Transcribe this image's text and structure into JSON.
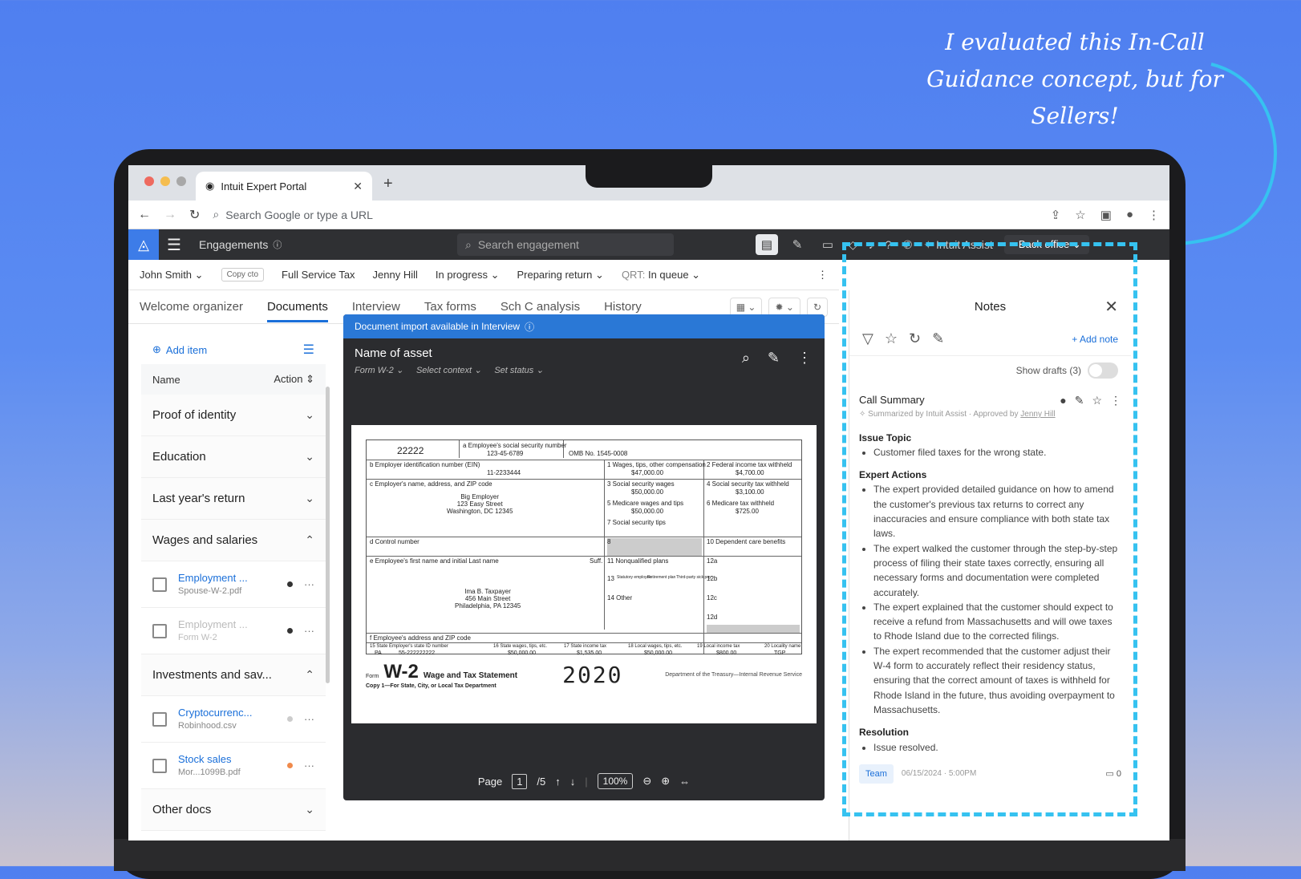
{
  "annotation": {
    "text": "I evaluated this In-Call Guidance concept, but for Sellers!"
  },
  "browser": {
    "tab_title": "Intuit Expert Portal",
    "url_placeholder": "Search Google or type a URL"
  },
  "appbar": {
    "section": "Engagements",
    "search_placeholder": "Search engagement",
    "assist": "Intuit Assist",
    "back_office": "Back office"
  },
  "engagement": {
    "client": "John Smith",
    "copy": "Copy cto",
    "service": "Full Service Tax",
    "expert": "Jenny Hill",
    "status": "In progress",
    "stage": "Preparing return",
    "qrt_label": "QRT:",
    "qrt_value": "In queue"
  },
  "subtabs": [
    "Welcome organizer",
    "Documents",
    "Interview",
    "Tax forms",
    "Sch C analysis",
    "History"
  ],
  "docs": {
    "add_item": "Add item",
    "col_name": "Name",
    "col_action": "Action",
    "sections": {
      "proof": "Proof of identity",
      "education": "Education",
      "last_year": "Last year's return",
      "wages": "Wages and salaries",
      "investments": "Investments and sav...",
      "other": "Other docs"
    },
    "wages_items": [
      {
        "title": "Employment ...",
        "file": "Spouse-W-2.pdf"
      },
      {
        "title": "Employment ...",
        "file": "Form W-2"
      }
    ],
    "invest_items": [
      {
        "title": "Cryptocurrenc...",
        "file": "Robinhood.csv"
      },
      {
        "title": "Stock sales",
        "file": "Mor...1099B.pdf"
      }
    ]
  },
  "viewer": {
    "banner": "Document import available in Interview",
    "name": "Name of asset",
    "form": "Form W-2",
    "context": "Select context",
    "status": "Set status",
    "page_label": "Page",
    "page": "1",
    "page_total": "/5",
    "zoom": "100%"
  },
  "w2": {
    "control": "22222",
    "ssn_label": "a Employee's social security number",
    "ssn": "123-45-6789",
    "omb": "OMB No. 1545-0008",
    "ein_label": "b Employer identification number (EIN)",
    "ein": "11-2233444",
    "employer_label": "c Employer's name, address, and ZIP code",
    "employer": "Big Employer\n123 Easy Street\nWashington, DC 12345",
    "box1_label": "1 Wages, tips, other compensation",
    "box1": "$47,000.00",
    "box2_label": "2 Federal income tax withheld",
    "box2": "$4,700.00",
    "box3_label": "3 Social security wages",
    "box3": "$50,000.00",
    "box4_label": "4 Social security tax withheld",
    "box4": "$3,100.00",
    "box5_label": "5 Medicare wages and tips",
    "box5": "$50,000.00",
    "box6_label": "6 Medicare tax withheld",
    "box6": "$725.00",
    "box7_label": "7 Social security tips",
    "box8": "8",
    "box10_label": "10 Dependent care benefits",
    "d_label": "d Control number",
    "e_label": "e Employee's first name and initial     Last name",
    "suff": "Suff.",
    "box11_label": "11 Nonqualified plans",
    "box12a": "12a",
    "box13": "13",
    "box13a": "Statutory employee",
    "box13b": "Retirement plan",
    "box13c": "Third-party sick pay",
    "box12b": "12b",
    "box14": "14 Other",
    "box12c": "12c",
    "box12d": "12d",
    "employee": "Ima B. Taxpayer\n456 Main Street\nPhiladelphia, PA 12345",
    "f_label": "f Employee's address and ZIP code",
    "state_label": "15 State  Employer's state ID number",
    "state": "PA",
    "state_id": "55-222222222",
    "box16_label": "16 State wages, tips, etc.",
    "box16": "$50,000.00",
    "box17_label": "17 State income tax",
    "box17": "$1,535.00",
    "box18_label": "18 Local wages, tips, etc.",
    "box18": "$50,000.00",
    "box19_label": "19 Local income tax",
    "box19": "$800.00",
    "box20_label": "20 Locality name",
    "box20": "TGP",
    "form": "Form",
    "title": "W-2",
    "subtitle": "Wage and Tax Statement",
    "year": "2020",
    "copy": "Copy 1—For State, City, or Local Tax Department",
    "dept": "Department of the Treasury—Internal Revenue Service"
  },
  "notes": {
    "title": "Notes",
    "add_note": "Add note",
    "show_drafts": "Show drafts (3)",
    "card_title": "Call Summary",
    "meta_prefix": "Summarized by Intuit Assist · Approved by ",
    "meta_name": "Jenny Hill",
    "issue_h": "Issue Topic",
    "issue": [
      "Customer filed taxes for the wrong state."
    ],
    "actions_h": "Expert Actions",
    "actions": [
      "The expert provided detailed guidance on how to amend the customer's previous tax returns to correct any inaccuracies and ensure compliance with both state tax laws.",
      "The expert walked the customer through the step-by-step process of filing their state taxes correctly, ensuring all necessary forms and documentation were completed accurately.",
      "The expert explained that the customer should expect to receive a refund from Massachusetts and will owe taxes to Rhode Island due to the corrected filings.",
      "The expert recommended that the customer adjust their W-4 form to accurately reflect their residency status, ensuring that the correct amount of taxes is withheld for Rhode Island in the future, thus avoiding overpayment to Massachusetts."
    ],
    "resolution_h": "Resolution",
    "resolution": [
      "Issue resolved."
    ],
    "tag": "Team",
    "date": "06/15/2024 · 5:00PM",
    "comments": "0"
  },
  "colors": {
    "accent": "#1a6fd9",
    "dashed": "#36c2f0",
    "banner": "#2a78d6"
  }
}
